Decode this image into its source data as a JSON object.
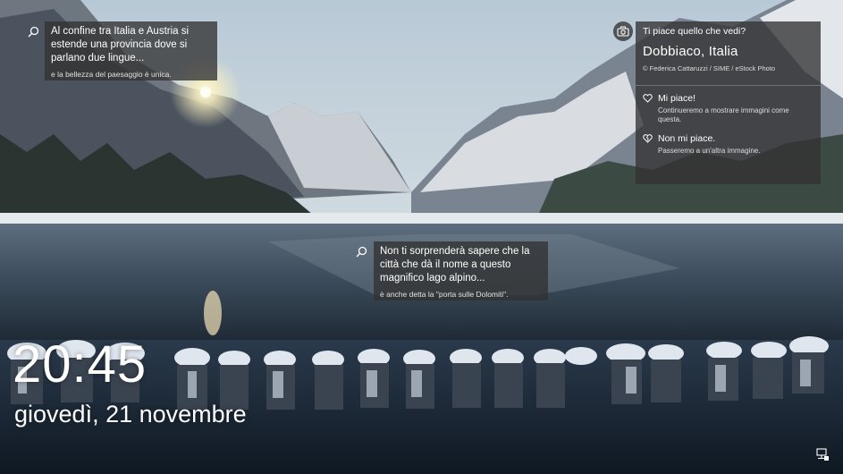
{
  "hint_top": {
    "title": "Al confine tra Italia e Austria si estende una provincia dove si parlano due lingue...",
    "subtitle": "e la bellezza del paesaggio è unica."
  },
  "hint_bottom": {
    "title": "Non ti sorprenderà sapere che la città che dà il nome a questo magnifico lago alpino...",
    "subtitle": "è anche detta la \"porta sulle Dolomiti\"."
  },
  "spotlight": {
    "question": "Ti piace quello che vedi?",
    "location": "Dobbiaco, Italia",
    "credit": "© Federica Cattaruzzi / SIME / eStock Photo",
    "like": {
      "label": "Mi piace!",
      "description": "Continueremo a mostrare immagini come questa."
    },
    "dislike": {
      "label": "Non mi piace.",
      "description": "Passeremo a un'altra immagine."
    }
  },
  "lock": {
    "time": "20:45",
    "date": "giovedì, 21 novembre"
  },
  "icons": {
    "hint": "search-icon",
    "spotlight": "camera-icon",
    "like": "heart-icon",
    "dislike": "heart-broken-icon",
    "tray": "network-icon"
  },
  "colors": {
    "panel": "#323232",
    "text": "#ffffff"
  }
}
